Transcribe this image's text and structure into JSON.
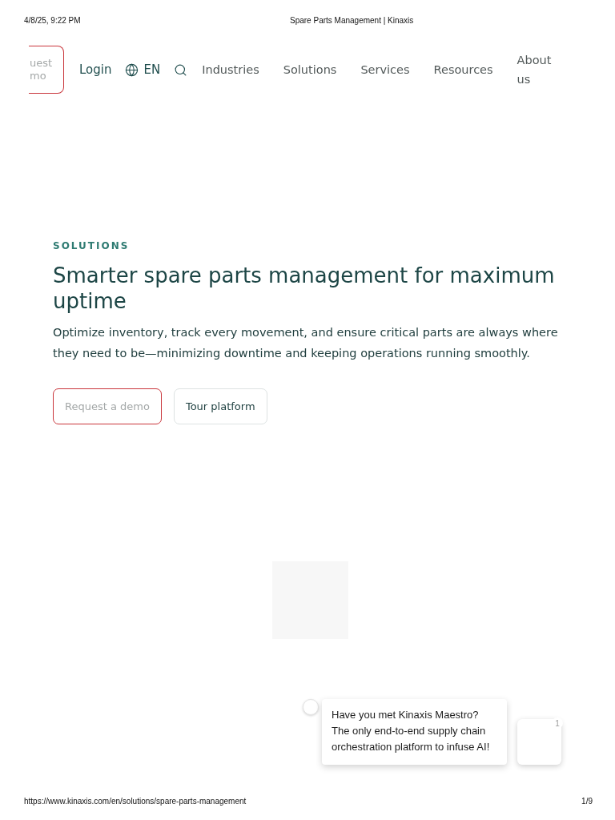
{
  "print_header": {
    "date": "4/8/25, 9:22 PM",
    "title": "Spare Parts Management | Kinaxis"
  },
  "nav": {
    "cut_button_lines": [
      "uest",
      "mo"
    ],
    "login": "Login",
    "language": "EN",
    "items": [
      {
        "label": "Industries"
      },
      {
        "label": "Solutions"
      },
      {
        "label": "Services"
      },
      {
        "label": "Resources"
      },
      {
        "label": "About us"
      }
    ]
  },
  "hero": {
    "eyebrow": "SOLUTIONS",
    "title": "Smarter spare parts management for maximum uptime",
    "description": "Optimize inventory, track every movement, and ensure critical parts are always where they need to be—minimizing downtime and keeping operations running smoothly.",
    "buttons": [
      {
        "label": "Request a demo",
        "kind": "primary"
      },
      {
        "label": "Tour platform",
        "kind": "secondary"
      }
    ]
  },
  "chat": {
    "message": "Have you met Kinaxis Maestro? The only end-to-end supply chain orchestration platform to infuse AI!",
    "badge": "1"
  },
  "print_footer": {
    "url": "https://www.kinaxis.com/en/solutions/spare-parts-management",
    "page": "1/9"
  }
}
